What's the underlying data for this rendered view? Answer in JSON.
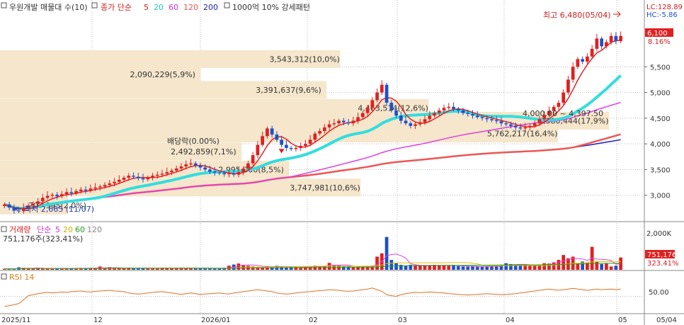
{
  "header": {
    "title": "우원개발 매물대 수(10)",
    "ma_label": "종가 단순",
    "ma_periods": [
      "5",
      "20",
      "60",
      "120",
      "200"
    ],
    "ma_colors": [
      "#e02020",
      "#33dddd",
      "#e040e0",
      "#ee5555",
      "#2020c0"
    ],
    "extra": "1000억 10% 강세패턴",
    "lc": "LC:128.89",
    "hc": "HC:-5.86"
  },
  "price_panel": {
    "y_ticks": [
      "5,500",
      "5,000",
      "4,500",
      "4,000",
      "3,500",
      "3,000"
    ],
    "ymin": 2500,
    "ymax": 6800,
    "current_price": "6,100",
    "current_change": "8.16%",
    "annotations": {
      "high": "최고 6,480(05/04)",
      "low": "최저 2,665 (11/07)",
      "dividend_line1": "배당락(0.00%)",
      "dividend_line2": "2,492,859(7,1%)",
      "range": "4,000.00 ~ 4,397.50"
    }
  },
  "volume_panel": {
    "title": "거래량",
    "ma_label": "단순",
    "ma_periods": [
      "5",
      "20",
      "60",
      "120"
    ],
    "ma_colors": [
      "#e040e0",
      "#e0c000",
      "#20a020",
      "#888888"
    ],
    "value_text": "751,176주(323,41%)",
    "y_tick": "2,000K",
    "current_value": "751,176",
    "current_pct": "323.41%"
  },
  "rsi_panel": {
    "title": "RSI 14",
    "y_tick": "50.00"
  },
  "x_axis": {
    "labels": [
      "2025/11",
      "12",
      "2026/01",
      "02",
      "03",
      "04",
      "05"
    ],
    "right_label": "05/04"
  },
  "chart_data": {
    "type": "candlestick",
    "title": "우원개발 매물대 수(10)",
    "x_dates": [
      "2025/11",
      "12",
      "2026/01",
      "02",
      "03",
      "04",
      "05"
    ],
    "price_range": [
      2500,
      6800
    ],
    "high": {
      "value": 6480,
      "date": "05/04"
    },
    "low": {
      "value": 2665,
      "date": "11/07"
    },
    "last_close": 6100,
    "volume_profile": [
      {
        "label": "3,543,312(10,0%)",
        "price": 5650,
        "pct": 10.0
      },
      {
        "label": "2,090,229(5,9%)",
        "price": 5350,
        "pct": 5.9
      },
      {
        "label": "3,391,637(9,6%)",
        "price": 5050,
        "pct": 9.6
      },
      {
        "label": "4,463,514(12,6%)",
        "price": 4700,
        "pct": 12.6
      },
      {
        "label": "6,380,444(17,9%)",
        "price": 4450,
        "pct": 17.9
      },
      {
        "label": "5,762,217(16,4%)",
        "price": 4200,
        "pct": 16.4
      },
      {
        "label": "2,492,859(7,1%)",
        "price": 3850,
        "pct": 7.1
      },
      {
        "label": "2,995,300(8,5%)",
        "price": 3500,
        "pct": 8.5
      },
      {
        "label": "3,747,981(10,6%)",
        "price": 3150,
        "pct": 10.6
      },
      {
        "label": "707,995(2,0%)",
        "price": 2800,
        "pct": 2.0
      }
    ],
    "close": [
      2820,
      2760,
      2700,
      2690,
      2750,
      2800,
      2830,
      2880,
      2950,
      2990,
      3010,
      2980,
      3020,
      3060,
      3040,
      3080,
      3110,
      3090,
      3130,
      3150,
      3170,
      3200,
      3230,
      3260,
      3300,
      3340,
      3380,
      3360,
      3330,
      3310,
      3340,
      3380,
      3400,
      3420,
      3450,
      3480,
      3520,
      3560,
      3600,
      3620,
      3580,
      3540,
      3500,
      3460,
      3440,
      3430,
      3410,
      3420,
      3400,
      3450,
      3520,
      3620,
      3780,
      3980,
      4150,
      4300,
      4180,
      4080,
      3980,
      3920,
      3900,
      3920,
      3960,
      4000,
      4080,
      4200,
      4250,
      4320,
      4380,
      4400,
      4450,
      4420,
      4400,
      4450,
      4520,
      4600,
      4700,
      4850,
      5000,
      5150,
      4800,
      4650,
      4550,
      4450,
      4400,
      4350,
      4380,
      4420,
      4480,
      4550,
      4600,
      4650,
      4700,
      4720,
      4680,
      4650,
      4600,
      4580,
      4550,
      4520,
      4500,
      4480,
      4460,
      4440,
      4400,
      4380,
      4350,
      4320,
      4300,
      4320,
      4350,
      4400,
      4480,
      4560,
      4640,
      4720,
      4800,
      5000,
      5250,
      5500,
      5650,
      5600,
      5700,
      5850,
      6050,
      5900,
      5980,
      6100,
      6000,
      6100
    ],
    "volume_k": [
      60,
      50,
      40,
      150,
      120,
      90,
      70,
      100,
      80,
      70,
      60,
      90,
      80,
      70,
      90,
      100,
      110,
      80,
      90,
      100,
      200,
      80,
      160,
      90,
      100,
      80,
      120,
      90,
      80,
      90,
      100,
      80,
      90,
      110,
      100,
      90,
      80,
      120,
      100,
      90,
      80,
      100,
      90,
      80,
      70,
      90,
      100,
      250,
      320,
      380,
      300,
      240,
      200,
      180,
      150,
      220,
      180,
      240,
      200,
      160,
      200,
      170,
      150,
      180,
      210,
      250,
      200,
      240,
      420,
      300,
      260,
      220,
      200,
      170,
      180,
      220,
      190,
      250,
      800,
      1000,
      2000,
      600,
      400,
      300,
      250,
      300,
      280,
      260,
      240,
      260,
      300,
      280,
      260,
      240,
      260,
      220,
      200,
      190,
      220,
      200,
      180,
      190,
      220,
      240,
      300,
      400,
      350,
      300,
      280,
      300,
      260,
      250,
      320,
      400,
      380,
      450,
      600,
      900,
      700,
      800,
      400,
      500,
      450,
      1400,
      500,
      350,
      380,
      200,
      250,
      750
    ],
    "rsi": [
      20,
      22,
      25,
      28,
      40,
      52,
      55,
      58,
      60,
      62,
      60,
      61,
      63,
      62,
      64,
      65,
      66,
      64,
      63,
      65,
      66,
      67,
      68,
      66,
      65,
      64,
      60,
      58,
      57,
      58,
      60,
      62,
      63,
      64,
      62,
      60,
      58,
      56,
      58,
      60,
      58,
      56,
      57,
      58,
      59,
      60,
      58,
      57,
      60,
      62,
      64,
      66,
      68,
      70,
      68,
      66,
      64,
      60,
      58,
      57,
      58,
      60,
      62,
      63,
      64,
      66,
      67,
      68,
      70,
      69,
      68,
      66,
      65,
      66,
      68,
      70,
      72,
      75,
      70,
      65,
      55,
      52,
      50,
      55,
      58,
      60,
      62,
      61,
      62,
      63,
      62,
      61,
      60,
      58,
      57,
      56,
      55,
      54,
      55,
      56,
      57,
      58,
      57,
      56,
      55,
      56,
      57,
      58,
      60,
      62,
      64,
      66,
      68,
      70,
      72,
      70,
      68,
      70,
      72,
      74,
      72,
      70,
      68,
      70,
      72,
      70,
      71,
      72,
      70,
      72
    ]
  }
}
